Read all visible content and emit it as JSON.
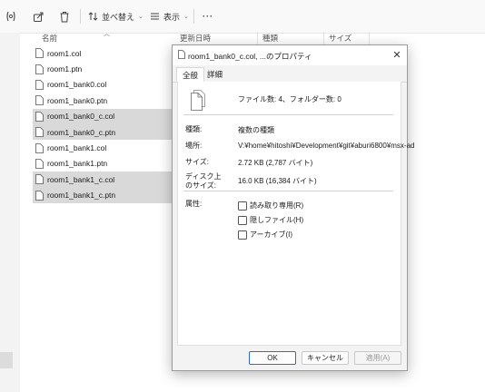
{
  "toolbar": {
    "sort_label": "並べ替え",
    "view_label": "表示",
    "more_label": "···"
  },
  "columns": {
    "name": "名前",
    "modified": "更新日時",
    "type": "種類",
    "size": "サイズ"
  },
  "files": [
    {
      "name": "room1.col",
      "selected": false
    },
    {
      "name": "room1.ptn",
      "selected": false
    },
    {
      "name": "room1_bank0.col",
      "selected": false
    },
    {
      "name": "room1_bank0.ptn",
      "selected": false
    },
    {
      "name": "room1_bank0_c.col",
      "selected": true
    },
    {
      "name": "room1_bank0_c.ptn",
      "selected": true
    },
    {
      "name": "room1_bank1.col",
      "selected": false
    },
    {
      "name": "room1_bank1.ptn",
      "selected": false
    },
    {
      "name": "room1_bank1_c.col",
      "selected": true
    },
    {
      "name": "room1_bank1_c.ptn",
      "selected": true
    }
  ],
  "dialog": {
    "title": "room1_bank0_c.col, ...のプロパティ",
    "close": "✕",
    "tabs": [
      "全般",
      "詳細"
    ],
    "file_count": "ファイル数: 4、フォルダー数: 0",
    "props": {
      "type_label": "種類:",
      "type_value": "複数の種類",
      "location_label": "場所:",
      "location_value": "V:¥home¥hitoshi¥Development¥git¥aburi6800¥msx-ad",
      "size_label": "サイズ:",
      "size_value": "2.72 KB (2,787 バイト)",
      "disk_label_1": "ディスク上",
      "disk_label_2": "のサイズ:",
      "disk_value": "16.0 KB (16,384 バイト)",
      "attr_label": "属性:",
      "readonly": "読み取り専用(R)",
      "hidden": "隠しファイル(H)",
      "archive": "アーカイブ(I)"
    },
    "buttons": {
      "ok": "OK",
      "cancel": "キャンセル",
      "apply": "適用(A)"
    }
  }
}
